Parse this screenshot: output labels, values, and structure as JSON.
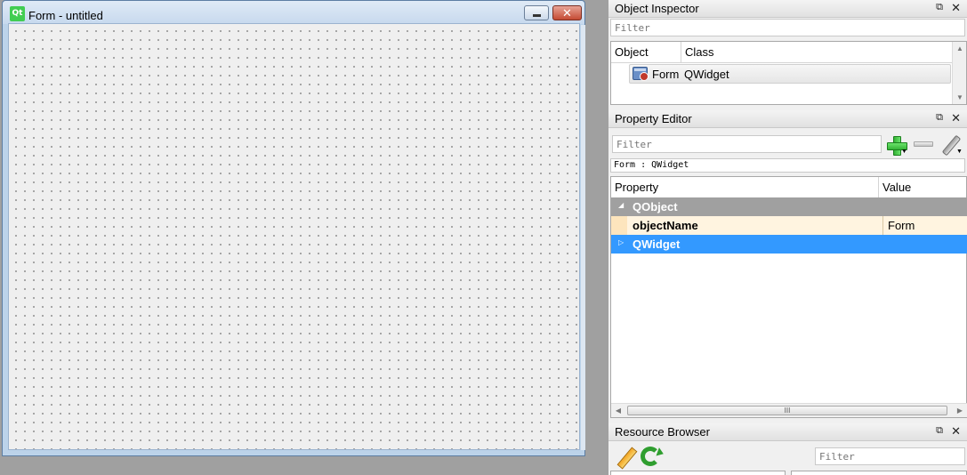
{
  "form_window": {
    "logo_text": "Qt",
    "title": "Form - untitled",
    "close_glyph": "✕"
  },
  "object_inspector": {
    "title": "Object Inspector",
    "filter_placeholder": "Filter",
    "columns": [
      "Object",
      "Class"
    ],
    "rows": [
      {
        "object": "Form",
        "class": "QWidget",
        "icon": "form-widget-icon"
      }
    ]
  },
  "property_editor": {
    "title": "Property Editor",
    "filter_placeholder": "Filter",
    "class_path": "Form : QWidget",
    "columns": [
      "Property",
      "Value"
    ],
    "rows": [
      {
        "type": "category",
        "name": "QObject",
        "expanded": true
      },
      {
        "type": "property",
        "name": "objectName",
        "value": "Form"
      },
      {
        "type": "category",
        "name": "QWidget",
        "expanded": false,
        "selected": true
      }
    ],
    "scroll_grip": "III"
  },
  "resource_browser": {
    "title": "Resource Browser",
    "filter_placeholder": "Filter"
  },
  "dock_controls": {
    "float_glyph": "⧉",
    "close_glyph": "✕"
  },
  "colors": {
    "selection": "#3399ff",
    "category_bg": "#a0a0a0",
    "property_bg": "#fff4e0",
    "canvas_bg": "#efefef"
  }
}
